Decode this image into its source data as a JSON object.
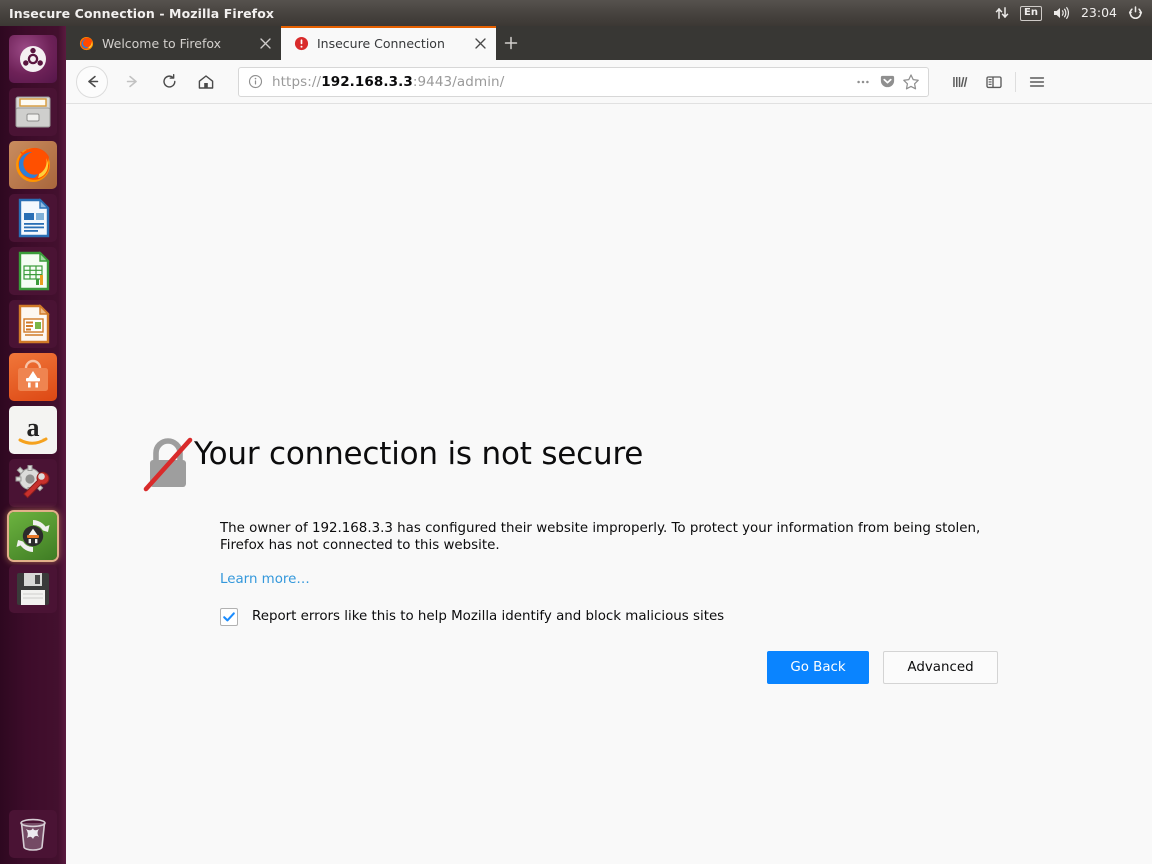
{
  "panel": {
    "window_title": "Insecure Connection - Mozilla Firefox",
    "tray": {
      "network_icon": "network-up-down-icon",
      "keyboard_layout": "En",
      "volume_icon": "volume-icon",
      "clock": "23:04",
      "session_icon": "system-power-gear-icon"
    }
  },
  "launcher": {
    "items": [
      {
        "name": "ubuntu-dash",
        "label": "Ubuntu Dash",
        "running": false,
        "focused": false
      },
      {
        "name": "files",
        "label": "Files",
        "running": false,
        "focused": false
      },
      {
        "name": "firefox",
        "label": "Firefox Web Browser",
        "running": true,
        "focused": false
      },
      {
        "name": "libreoffice-writer",
        "label": "LibreOffice Writer",
        "running": false,
        "focused": false
      },
      {
        "name": "libreoffice-calc",
        "label": "LibreOffice Calc",
        "running": false,
        "focused": false
      },
      {
        "name": "libreoffice-impress",
        "label": "LibreOffice Impress",
        "running": false,
        "focused": false
      },
      {
        "name": "ubuntu-software",
        "label": "Ubuntu Software",
        "running": false,
        "focused": false
      },
      {
        "name": "amazon",
        "label": "Amazon",
        "running": false,
        "focused": false
      },
      {
        "name": "system-settings",
        "label": "System Settings",
        "running": false,
        "focused": false
      },
      {
        "name": "software-updater",
        "label": "Software Updater",
        "running": true,
        "focused": true
      },
      {
        "name": "disk-image-writer",
        "label": "Startup Disk Creator",
        "running": false,
        "focused": false
      }
    ],
    "trash": {
      "name": "trash",
      "label": "Trash"
    }
  },
  "browser": {
    "tabs": [
      {
        "title": "Welcome to Firefox",
        "favicon": "firefox-icon",
        "active": false,
        "close_label": "×"
      },
      {
        "title": "Insecure Connection",
        "favicon": "warning-icon",
        "active": true,
        "close_label": "×"
      }
    ],
    "new_tab_label": "+",
    "nav": {
      "back": "back-arrow-icon",
      "forward": "forward-arrow-icon",
      "reload": "reload-icon",
      "home": "home-icon"
    },
    "urlbar": {
      "identity_icon": "info-circle-icon",
      "scheme": "https://",
      "host": "192.168.3.3",
      "rest": ":9443/admin/",
      "full_url": "https://192.168.3.3:9443/admin/",
      "page_actions_icon": "ellipsis-icon",
      "pocket_icon": "pocket-icon",
      "bookmark_icon": "star-icon"
    },
    "toolbar_right": {
      "library": "library-icon",
      "sidebar": "sidebar-icon",
      "menu": "hamburger-menu-icon"
    }
  },
  "errorpage": {
    "icon": "broken-padlock-icon",
    "title": "Your connection is not secure",
    "description": "The owner of 192.168.3.3 has configured their website improperly. To protect your information from being stolen, Firefox has not connected to this website.",
    "learn_more": "Learn more…",
    "report_checkbox_checked": true,
    "report_label": "Report errors like this to help Mozilla identify and block malicious sites",
    "buttons": {
      "primary": "Go Back",
      "secondary": "Advanced"
    }
  },
  "colors": {
    "accent_blue": "#0a84ff",
    "link_blue": "#3498db",
    "tab_accent_orange": "#e66000",
    "launcher_purple": "#3d0c2a",
    "panel_gray": "#46423e",
    "warning_red": "#d92b2b"
  }
}
